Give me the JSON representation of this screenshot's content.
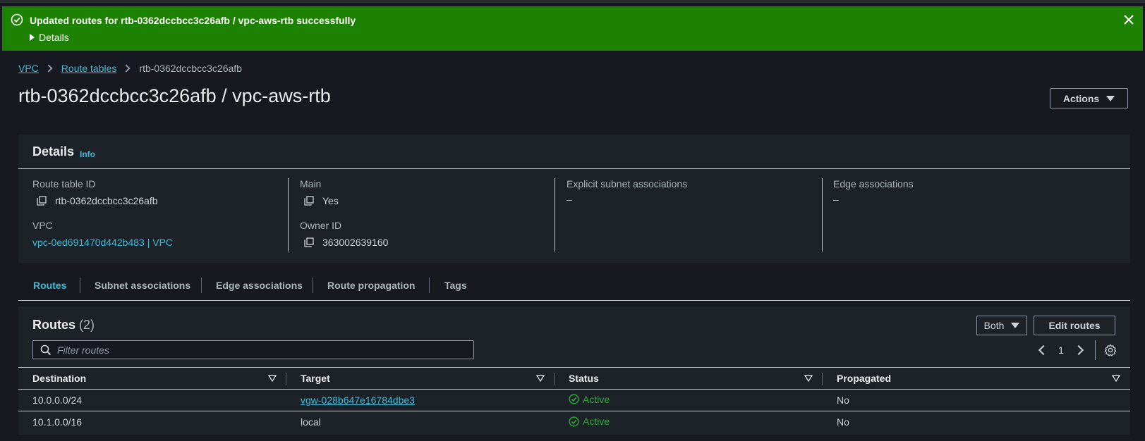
{
  "flash": {
    "message": "Updated routes for rtb-0362dccbcc3c26afb / vpc-aws-rtb successfully",
    "details_label": "Details"
  },
  "breadcrumb": [
    "VPC",
    "Route tables",
    "rtb-0362dccbcc3c26afb"
  ],
  "page_title": "rtb-0362dccbcc3c26afb / vpc-aws-rtb",
  "actions_label": "Actions",
  "details": {
    "heading": "Details",
    "info_label": "Info",
    "route_table_id_label": "Route table ID",
    "route_table_id": "rtb-0362dccbcc3c26afb",
    "vpc_label": "VPC",
    "vpc_value": "vpc-0ed691470d442b483 | VPC",
    "main_label": "Main",
    "main_value": "Yes",
    "owner_label": "Owner ID",
    "owner_value": "363002639160",
    "explicit_label": "Explicit subnet associations",
    "explicit_value": "–",
    "edge_label": "Edge associations",
    "edge_value": "–"
  },
  "tabs": [
    "Routes",
    "Subnet associations",
    "Edge associations",
    "Route propagation",
    "Tags"
  ],
  "routes": {
    "title": "Routes",
    "count": "(2)",
    "both_label": "Both",
    "edit_label": "Edit routes",
    "filter_placeholder": "Filter routes",
    "page": "1",
    "columns": [
      "Destination",
      "Target",
      "Status",
      "Propagated"
    ],
    "rows": [
      {
        "destination": "10.0.0.0/24",
        "target": "vgw-028b647e16784dbe3",
        "status": "Active",
        "propagated": "No"
      },
      {
        "destination": "10.1.0.0/16",
        "target": "local",
        "status": "Active",
        "propagated": "No"
      }
    ]
  },
  "colors": {
    "success_banner": "#1d8102",
    "link": "#44b9d6",
    "status_active": "#29ad32"
  }
}
